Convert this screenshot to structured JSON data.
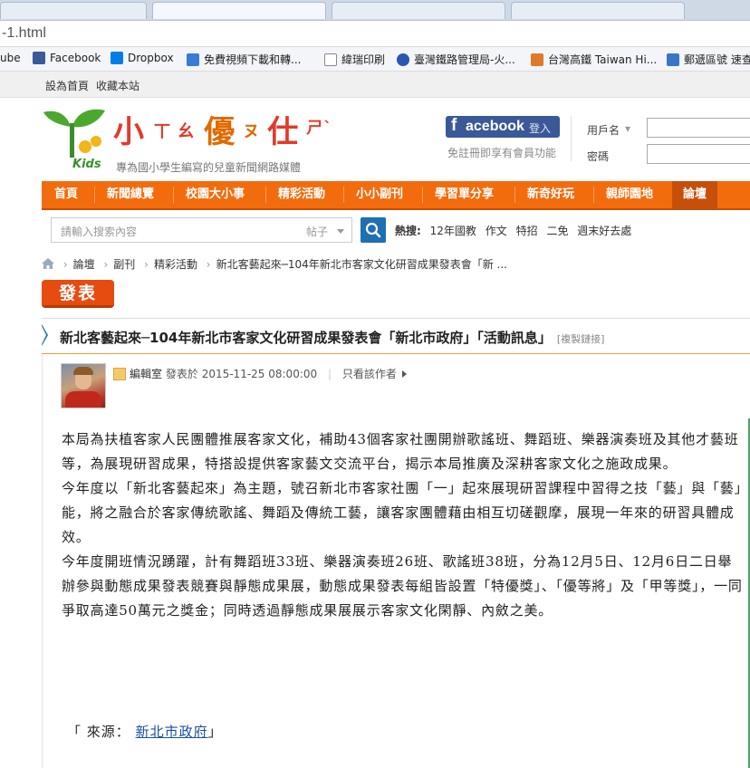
{
  "browser": {
    "url_fragment": "-1.html",
    "bookmarks": [
      {
        "label": "ube",
        "color": "#cc0000"
      },
      {
        "label": "Facebook",
        "color": "#3b5998"
      },
      {
        "label": "Dropbox",
        "color": "#007ee5"
      },
      {
        "label": "免費視頻下載和轉...",
        "color": "#3a7bd5"
      },
      {
        "label": "緯瑞印刷",
        "color": "#888888"
      },
      {
        "label": "臺灣鐵路管理局-火...",
        "color": "#2a55b0"
      },
      {
        "label": "台灣高鐵 Taiwan Hi...",
        "color": "#e07a2a"
      },
      {
        "label": "郵遞區號 速查",
        "color": "#3a76c4"
      }
    ]
  },
  "topstrip": {
    "set_home": "設為首頁",
    "bookmark": "收藏本站"
  },
  "site": {
    "brand": "小",
    "brand_rest": "優",
    "brand_tail": "仕",
    "kids": "Kids",
    "tagline": "專為國小學生編寫的兒童新聞網路媒體",
    "facebook_f": "f",
    "facebook_text": "acebook",
    "facebook_login": "登入",
    "facebook_note": "免註冊即享有會員功能",
    "username_label": "用戶名",
    "password_label": "密碼"
  },
  "nav": {
    "items": [
      "首頁",
      "新聞總覽",
      "校園大小事",
      "精彩活動",
      "小小副刊",
      "學習單分享",
      "新奇好玩",
      "親師園地",
      "論壇"
    ]
  },
  "search": {
    "placeholder": "請輸入搜索內容",
    "type": "帖子",
    "hot_label": "熱搜:",
    "hot_terms": [
      "12年國教",
      "作文",
      "特招",
      "二免",
      "週末好去處"
    ]
  },
  "breadcrumb": {
    "items": [
      "論壇",
      "副刊",
      "精彩活動",
      "新北客藝起來─104年新北市客家文化研習成果發表會「新 ..."
    ]
  },
  "publish_label": "發表",
  "thread": {
    "title": "新北客藝起來─104年新北市客家文化研習成果發表會「新北市政府」「活動訊息」",
    "copy_link": "[複製鏈接]",
    "author": "編輯室",
    "posted_prefix": "發表於",
    "posted_at": "2015-11-25 08:00:00",
    "only_author": "只看該作者"
  },
  "content": {
    "paragraphs": [
      "本局為扶植客家人民團體推展客家文化，補助43個客家社團開辦歌謠班、舞蹈班、樂器演奏班及其他才藝班等，為展現研習成果，特搭設提供客家藝文交流平台，揭示本局推廣及深耕客家文化之施政成果。",
      "今年度以「新北客藝起來」為主題，號召新北市客家社團「一」起來展現研習課程中習得之技「藝」與「藝」能，將之融合於客家傳統歌謠、舞蹈及傳統工藝，讓客家團體藉由相互切磋觀摩，展現一年來的研習具體成效。",
      "今年度開班情況踴躍，計有舞蹈班33班、樂器演奏班26班、歌謠班38班，分為12月5日、12月6日二日舉辦參與動態成果發表競賽與靜態成果展，動態成果發表每組皆設置「特優獎」、「優等將」及「甲等獎」，一同爭取高達50萬元之獎金；同時透過靜態成果展展示客家文化閑靜、內斂之美。"
    ],
    "source_label": "「 來源：",
    "source_link": "新北市政府",
    "source_end": "」"
  }
}
